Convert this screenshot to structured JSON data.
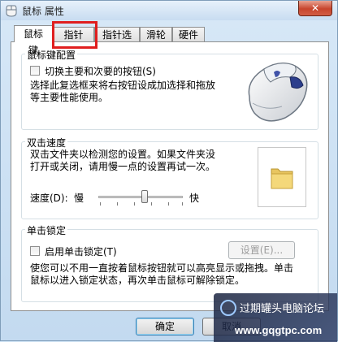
{
  "window": {
    "title": "鼠标 属性",
    "close_label": "✕"
  },
  "tabs": [
    {
      "label": "鼠标键",
      "active": true
    },
    {
      "label": "指针",
      "active": false
    },
    {
      "label": "指针选项",
      "active": false
    },
    {
      "label": "滑轮",
      "active": false
    },
    {
      "label": "硬件",
      "active": false
    }
  ],
  "button_config": {
    "legend": "鼠标键配置",
    "swap_label": "切换主要和次要的按钮(S)",
    "swap_checked": false,
    "description_line1": "选择此复选框来将右按钮设成加选择和拖放",
    "description_line2": "等主要性能使用。"
  },
  "double_click": {
    "legend": "双击速度",
    "description_line1": "双击文件夹以检测您的设置。如果文件夹没",
    "description_line2": "打开或关闭，请用慢一点的设置再试一次。",
    "speed_label": "速度(D):",
    "slow_label": "慢",
    "fast_label": "快",
    "speed_level_fraction": 0.55
  },
  "click_lock": {
    "legend": "单击锁定",
    "enable_label": "启用单击锁定(T)",
    "enable_checked": false,
    "settings_button": "设置(E)...",
    "description_line1": "使您可以不用一直按着鼠标按钮就可以高亮显示或拖拽。单击",
    "description_line2": "鼠标以进入锁定状态，再次单击鼠标可解除锁定。"
  },
  "footer": {
    "ok_label": "确定",
    "cancel_label": "取消"
  },
  "watermark": {
    "line1": "过期罐头电脑论坛",
    "line2": "www.gqgtpc.com"
  },
  "colors": {
    "highlight": "#e01e1e",
    "window_bg": "#c3daf0",
    "close": "#c7452d"
  },
  "icons": [
    "mouse-icon",
    "folder-icon",
    "mouse-properties-icon",
    "close-icon"
  ]
}
